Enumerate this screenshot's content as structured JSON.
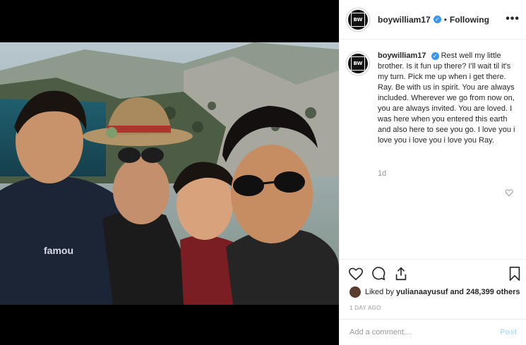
{
  "post": {
    "username": "boywilliam17",
    "follow_status": "Following",
    "separator": "•",
    "more": "•••",
    "avatar_logo": "BW",
    "caption": "Rest well my little brother. Is it fun up there? I'll wait til it's my turn. Pick me up when i get there. Ray. Be with us in spirit. You are always included. Wherever we go from now on, you are always invited. You are loved. I was here when you entered this earth and also here to see you go. I love you i love you i love you i love you Ray.",
    "caption_age": "1d",
    "liked_by_prefix": "Liked by",
    "liked_by_user": "yulianaayusuf",
    "liked_by_suffix": "and 248,399 others",
    "date": "1 DAY AGO",
    "comment_placeholder": "Add a comment...",
    "post_label": "Post"
  },
  "icons": {
    "like": "heart-icon",
    "comment": "comment-icon",
    "share": "share-icon",
    "save": "bookmark-icon",
    "caption_like": "heart-icon",
    "verified": "verified-badge-icon"
  },
  "colors": {
    "verified": "#3897f0",
    "post_button": "#b2dffc",
    "muted_text": "#999999"
  }
}
